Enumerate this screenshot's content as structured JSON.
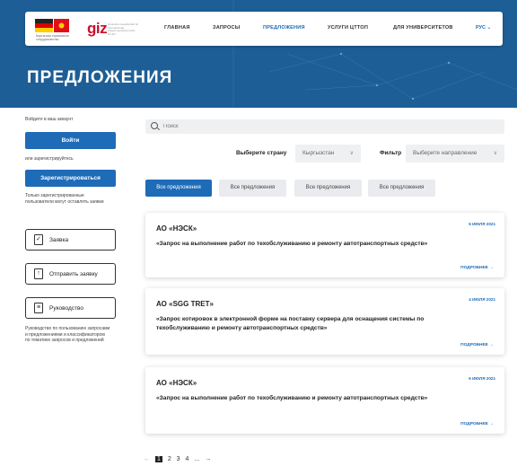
{
  "nav": {
    "logo_text": "Кыргызско-германское сотрудничество",
    "giz": "giz",
    "giz_sub": "Deutsche Gesellschaft für Internationale Zusammenarbeit (GIZ) GmbH",
    "items": [
      "ГЛАВНАЯ",
      "ЗАПРОСЫ",
      "ПРЕДЛОЖЕНИЯ",
      "УСЛУГИ ЦТТОП",
      "ДЛЯ УНИВЕРСИТЕТОВ"
    ],
    "lang": "РУС ⌄"
  },
  "hero": {
    "title": "ПРЕДЛОЖЕНИЯ"
  },
  "sidebar": {
    "login_prompt": "Войдите в ваш аккаунт",
    "login_button": "Войти",
    "or_register": "или зарегистрируйтесь",
    "register_button": "Зарегистрироваться",
    "note": "Только зарегистрированные пользователи могут оставлять заявки",
    "buttons": [
      "Заявка",
      "Отправить заявку",
      "Руководство"
    ],
    "guide_note": "Руководство по пользованию запросами и предложениями и классификатором по тематике запросов и предложений"
  },
  "search": {
    "placeholder": "Поиск"
  },
  "filters": {
    "country_label": "Выберите страну",
    "country_value": "Кыргызстан",
    "filter_label": "Фильтр",
    "direction_value": "Выберите направление"
  },
  "tabs": [
    "Все предложения",
    "Все предложения",
    "Все предложения",
    "Все предложения"
  ],
  "cards": [
    {
      "date": "6 ИЮЛЯ 2021",
      "org": "АО «НЭСК»",
      "desc": "«Запрос на выполнение работ по техобслуживанию и ремонту автотранспортных средств»",
      "more": "ПОДРОБНЕЕ →"
    },
    {
      "date": "4 ИЮЛЯ 2021",
      "org": "АО «SGG TRET»",
      "desc": "«Запрос котировок в электронной форме на поставку сервера для оснащения системы по техобслуживанию и ремонту автотранспортных средств»",
      "more": "ПОДРОБНЕЕ →"
    },
    {
      "date": "6 ИЮЛЯ 2021",
      "org": "АО «НЭСК»",
      "desc": "«Запрос на выполнение работ по техобслуживанию и ремонту автотранспортных средств»",
      "more": "ПОДРОБНЕЕ →"
    }
  ],
  "pager": {
    "prev": "←",
    "pages": [
      "1",
      "2",
      "3",
      "4"
    ],
    "ellipsis": "...",
    "next": "→"
  },
  "colors": {
    "brand_blue": "#1e6bb8",
    "hero_blue": "#1e5e96",
    "giz_red": "#c8102e"
  }
}
